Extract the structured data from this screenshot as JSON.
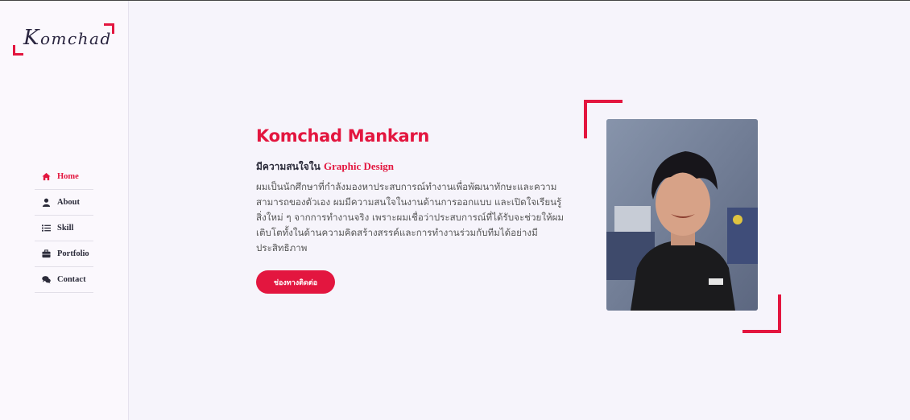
{
  "brand": {
    "logo_text_first": "K",
    "logo_text_rest": "omchad"
  },
  "nav": [
    {
      "label": "Home",
      "icon": "home-icon",
      "active": true
    },
    {
      "label": "About",
      "icon": "user-icon",
      "active": false
    },
    {
      "label": "Skill",
      "icon": "list-icon",
      "active": false
    },
    {
      "label": "Portfolio",
      "icon": "briefcase-icon",
      "active": false
    },
    {
      "label": "Contact",
      "icon": "comments-icon",
      "active": false
    }
  ],
  "hero": {
    "name": "Komchad Mankarn",
    "subtitle_prefix": "มีความสนใจใน",
    "subtitle_accent": "Graphic Design",
    "description": "ผมเป็นนักศึกษาที่กำลังมองหาประสบการณ์ทำงานเพื่อพัฒนาทักษะและความสามารถของตัวเอง ผมมีความสนใจในงานด้านการออกแบบ และเปิดใจเรียนรู้สิ่งใหม่ ๆ จากการทำงานจริง เพราะผมเชื่อว่าประสบการณ์ที่ได้รับจะช่วยให้ผมเติบโตทั้งในด้านความคิดสร้างสรรค์และการทำงานร่วมกับทีมได้อย่างมีประสิทธิภาพ",
    "contact_button": "ช่องทางติดต่อ"
  },
  "colors": {
    "accent": "#e3163f",
    "sidebar_bg": "#fbf8fd",
    "page_bg": "#f6f4fb"
  }
}
